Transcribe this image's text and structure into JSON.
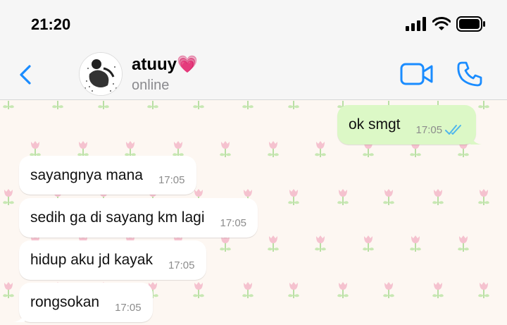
{
  "status_bar": {
    "time": "21:20",
    "icons": [
      "signal-icon",
      "wifi-icon",
      "battery-icon"
    ]
  },
  "header": {
    "contact_name": "atuuy💗",
    "status": "online",
    "icons": [
      "back-chevron-icon",
      "video-call-icon",
      "phone-call-icon"
    ]
  },
  "messages": [
    {
      "direction": "out",
      "text": "ok smgt",
      "time": "17:05",
      "read": true
    },
    {
      "direction": "in",
      "text": "sayangnya mana",
      "time": "17:05"
    },
    {
      "direction": "in",
      "text": "sedih ga di sayang km lagi",
      "time": "17:05"
    },
    {
      "direction": "in",
      "text": "hidup aku jd kayak",
      "time": "17:05"
    },
    {
      "direction": "in",
      "text": "rongsokan",
      "time": "17:05"
    }
  ],
  "colors": {
    "accent": "#1a8cff",
    "outgoing_bubble": "#dcf8c6",
    "incoming_bubble": "#ffffff",
    "read_ticks": "#4fb6ec",
    "wallpaper": "#fdf7f2"
  }
}
